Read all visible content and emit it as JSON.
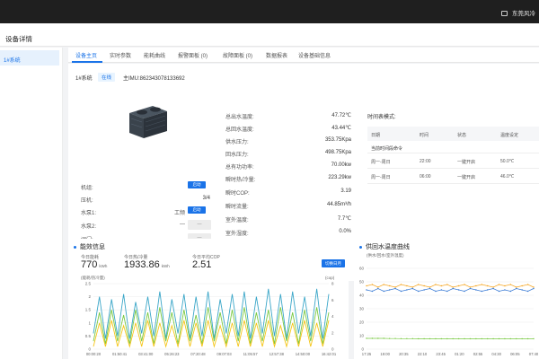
{
  "topbar": {
    "user_label": "东莞风冷"
  },
  "header": {
    "title": "设备详情"
  },
  "sidebar": {
    "items": [
      {
        "label": "1#系统"
      }
    ]
  },
  "tabs": [
    {
      "label": "设备主页"
    },
    {
      "label": "实时参数"
    },
    {
      "label": "能耗曲线"
    },
    {
      "label": "报警面板 (0)"
    },
    {
      "label": "故障面板 (0)"
    },
    {
      "label": "数据报表"
    },
    {
      "label": "设备基础信息"
    }
  ],
  "device": {
    "name": "1#系统",
    "status": "在线",
    "imei": "主IMU:862343078133692"
  },
  "params": [
    {
      "label": "机组:",
      "button": "启动"
    },
    {
      "label": "压机:",
      "value": "3/4"
    },
    {
      "label": "水泵1:",
      "value": "工频",
      "button": "启动"
    },
    {
      "label": "水泵2:",
      "value": "—",
      "button": "—"
    },
    {
      "label": "阀门:",
      "button": "—"
    }
  ],
  "readings": [
    {
      "label": "总出水温度:",
      "value": "47.72℃"
    },
    {
      "label": "总回水温度:",
      "value": "43.44℃"
    },
    {
      "label": "供水压力:",
      "value": "353.75Kpa"
    },
    {
      "label": "回水压力:",
      "value": "498.75Kpa"
    },
    {
      "label": "总有功功率:",
      "value": "70.00kw"
    },
    {
      "label": "瞬时热/冷量:",
      "value": "223.29kw"
    },
    {
      "label": "瞬时COP:",
      "value": "3.19"
    },
    {
      "label": "瞬时流量:",
      "value": "44.85m³/h"
    },
    {
      "label": "室外温度:",
      "value": "7.7℃"
    },
    {
      "label": "室外湿度:",
      "value": "0.0%"
    }
  ],
  "timetable": {
    "title": "时间表模式:",
    "headers": [
      "日期",
      "时间",
      "状态",
      "温度设定"
    ],
    "group_label": "当前时间段命令",
    "rows": [
      {
        "day": "周一-周日",
        "time": "22:00",
        "state": "一键开启",
        "temp": "50.0℃"
      },
      {
        "day": "周一-周日",
        "time": "06:00",
        "state": "一键开启",
        "temp": "46.0℃"
      }
    ]
  },
  "energy": {
    "title": "能效信息",
    "stats": [
      {
        "label": "今日能耗",
        "value": "770",
        "unit": "kWh"
      },
      {
        "label": "今日热/冷量",
        "value": "1933.86",
        "unit": "kWh"
      },
      {
        "label": "今日平均COP",
        "value": "2.51",
        "unit": ""
      }
    ],
    "switch_label": "切换日月"
  },
  "water_temp": {
    "title": "供回水温度曲线"
  },
  "chart_data": [
    {
      "type": "line",
      "ylabel": "(能耗/热冷量)",
      "y2label": "(cop)",
      "ylim": [
        0,
        2.5
      ],
      "y2lim": [
        0,
        8
      ],
      "yticks": [
        "0",
        "0.5",
        "1",
        "1.5",
        "2",
        "2.5"
      ],
      "y2ticks": [
        "0",
        "2",
        "4",
        "6",
        "8"
      ],
      "xticks": [
        "00:00:20",
        "01:50:41",
        "03:41:00",
        "05:26:23",
        "07:20:48",
        "09:07:03",
        "11:05:57",
        "12:57:38",
        "14:50:00",
        "16:42:01"
      ],
      "series": [
        {
          "color": "#3aa6c8",
          "values": [
            0.6,
            2.0,
            0.4,
            1.9,
            0.5,
            2.1,
            0.4,
            1.8,
            0.6,
            2.0,
            0.5,
            2.2,
            0.4,
            1.9,
            0.6,
            2.1,
            0.4,
            2.0,
            0.5,
            2.2,
            0.4,
            1.9,
            0.6,
            2.1,
            0.5,
            2.2,
            0.4,
            2.0,
            0.6,
            2.3,
            0.5,
            2.1,
            0.4,
            2.2,
            0.6,
            2.0,
            0.5,
            2.3,
            0.4,
            2.1
          ]
        },
        {
          "color": "#7ac943",
          "values": [
            0.3,
            1.4,
            0.2,
            1.5,
            0.3,
            1.3,
            0.2,
            1.5,
            0.3,
            1.4,
            0.2,
            1.6,
            0.3,
            1.4,
            0.2,
            1.5,
            0.3,
            1.3,
            0.2,
            1.6,
            0.3,
            1.4,
            0.2,
            1.5,
            0.3,
            1.6,
            0.2,
            1.4,
            0.3,
            1.5,
            0.2,
            1.6,
            0.3,
            1.4,
            0.2,
            1.5,
            0.3,
            1.6,
            0.2,
            1.4
          ]
        },
        {
          "color": "#f5c518",
          "values": [
            0.1,
            1.0,
            0.1,
            1.1,
            0.1,
            0.9,
            0.1,
            1.0,
            0.1,
            1.1,
            0.1,
            1.0,
            0.1,
            0.9,
            0.1,
            1.1,
            0.1,
            1.0,
            0.1,
            1.1,
            0.1,
            0.9,
            0.1,
            1.0,
            0.1,
            1.1,
            0.1,
            1.0,
            0.1,
            1.1,
            0.1,
            0.9,
            0.1,
            1.0,
            0.1,
            1.1,
            0.1,
            1.0,
            0.1,
            1.1
          ]
        }
      ]
    },
    {
      "type": "line",
      "ylabel": "(供水/回水/室外温度)",
      "ylim": [
        0,
        60
      ],
      "yticks": [
        "0",
        "10",
        "20",
        "30",
        "40",
        "50",
        "60"
      ],
      "xticks": [
        "17:25",
        "19:00",
        "20:35",
        "22:10",
        "23:45",
        "01:20",
        "02:55",
        "04:30",
        "06:05",
        "07:40"
      ],
      "series": [
        {
          "color": "#f5a623",
          "values": [
            47,
            48,
            46,
            48,
            47,
            46,
            48,
            47,
            46,
            48,
            47,
            46,
            48,
            47,
            48,
            46,
            47,
            48,
            46,
            47,
            48,
            47,
            46,
            48,
            47,
            48,
            46,
            47,
            48,
            46
          ]
        },
        {
          "color": "#3a7bd5",
          "values": [
            44,
            43,
            45,
            43,
            44,
            45,
            43,
            44,
            45,
            43,
            44,
            45,
            43,
            44,
            43,
            45,
            44,
            43,
            45,
            44,
            43,
            44,
            45,
            43,
            44,
            43,
            45,
            44,
            43,
            45
          ]
        },
        {
          "color": "#7ac943",
          "values": [
            8,
            8,
            8,
            8,
            7.9,
            7.9,
            7.8,
            7.8,
            7.8,
            7.7,
            7.7,
            7.7,
            7.7,
            7.7,
            7.7,
            7.7,
            7.7,
            7.7,
            7.7,
            7.7,
            7.7,
            7.7,
            7.7,
            7.7,
            7.7,
            7.7,
            7.7,
            7.7,
            7.7,
            7.7
          ]
        }
      ]
    }
  ]
}
